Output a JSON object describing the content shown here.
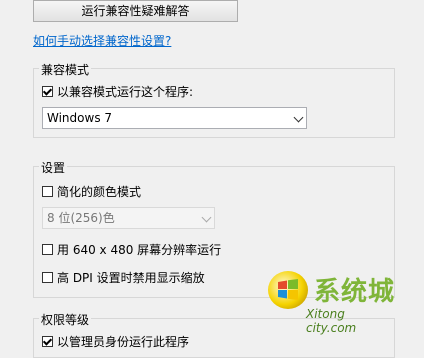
{
  "top_button": "运行兼容性疑难解答",
  "help_link": "如何手动选择兼容性设置?",
  "compat_group": {
    "title": "兼容模式",
    "checkbox_label": "以兼容模式运行这个程序:",
    "checkbox_checked": true,
    "os_selected": "Windows 7"
  },
  "settings_group": {
    "title": "设置",
    "reduced_color_label": "简化的颜色模式",
    "color_depth_selected": "8 位(256)色",
    "resolution_label": "用 640 x 480 屏幕分辨率运行",
    "dpi_label": "高 DPI 设置时禁用显示缩放"
  },
  "privilege_group": {
    "title": "权限等级",
    "admin_label": "以管理员身份运行此程序",
    "admin_checked": true
  },
  "watermark": {
    "text": "系统城",
    "sub": "Xitong city.com"
  }
}
